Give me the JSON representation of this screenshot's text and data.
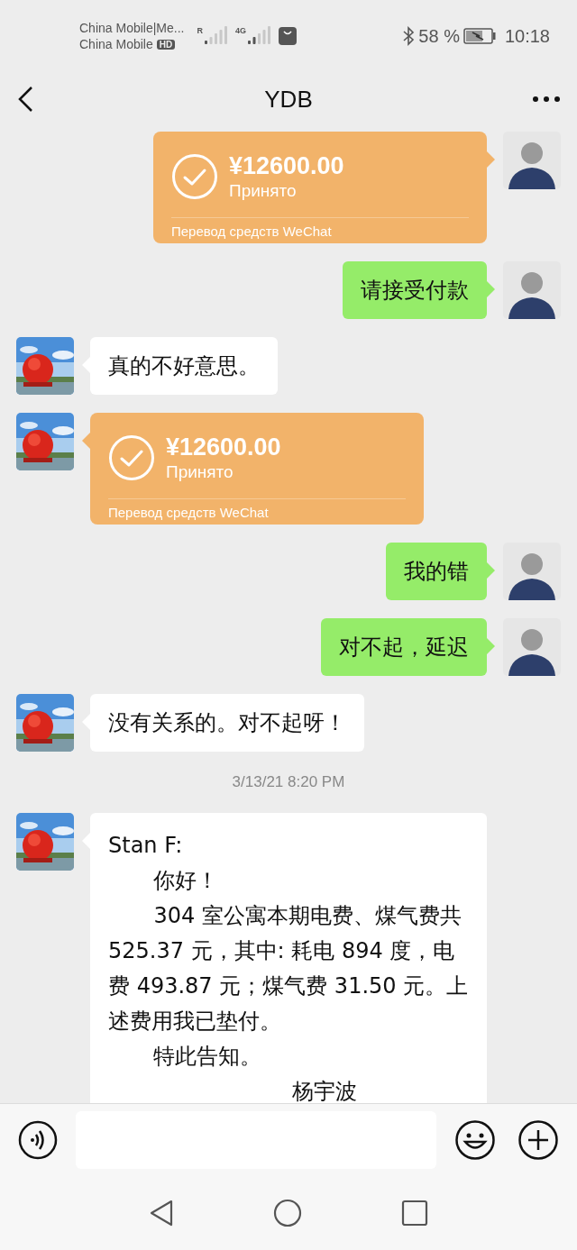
{
  "status_bar": {
    "carrier_1": "China Mobile|Me...",
    "carrier_2": "China Mobile",
    "hd_badge": "HD",
    "sim1_label": "R",
    "sim2_label": "4G",
    "battery": "58 %",
    "time": "10:18"
  },
  "header": {
    "title": "YDB"
  },
  "messages": [
    {
      "kind": "transfer",
      "outgoing": true,
      "amount": "¥12600.00",
      "status": "Принято",
      "footer": "Перевод средств WeChat"
    },
    {
      "kind": "text",
      "outgoing": true,
      "text": "请接受付款"
    },
    {
      "kind": "text",
      "outgoing": false,
      "text": "真的不好意思。"
    },
    {
      "kind": "transfer",
      "outgoing": false,
      "amount": "¥12600.00",
      "status": "Принято",
      "footer": "Перевод средств WeChat"
    },
    {
      "kind": "text",
      "outgoing": true,
      "text": "我的错"
    },
    {
      "kind": "text",
      "outgoing": true,
      "text": "对不起，延迟"
    },
    {
      "kind": "text",
      "outgoing": false,
      "text": "没有关系的。对不起呀！"
    },
    {
      "kind": "time",
      "text": "3/13/21 8:20 PM"
    },
    {
      "kind": "letter",
      "outgoing": false,
      "paragraphs": [
        {
          "kind": "plain",
          "text": "Stan F:"
        },
        {
          "kind": "indented",
          "text": "你好！"
        },
        {
          "kind": "indented",
          "text": "304 室公寓本期电费、煤气费共 525.37 元，其中: 耗电 894 度，电费 493.87 元；煤气费 31.50 元。上述费用我已垫付。"
        },
        {
          "kind": "indented",
          "text": "特此告知。"
        },
        {
          "kind": "signature",
          "text": "杨宇波"
        }
      ]
    }
  ]
}
